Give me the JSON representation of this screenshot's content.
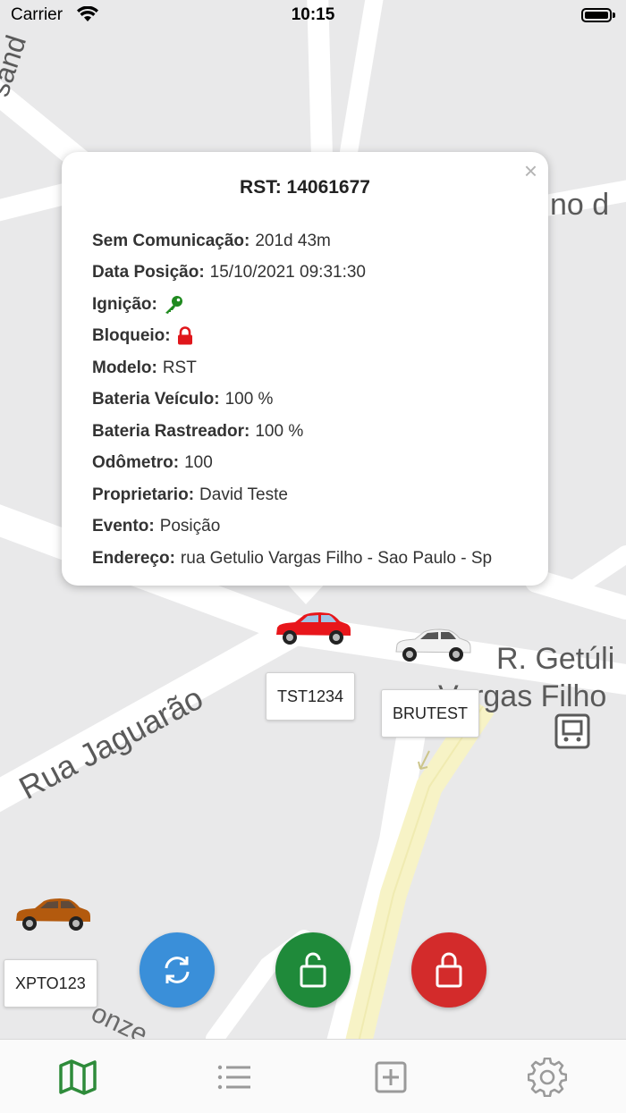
{
  "status_bar": {
    "carrier": "Carrier",
    "time": "10:15"
  },
  "map": {
    "street_labels": [
      "Rua Jaguarão",
      "R. Getúli",
      "Vargas Filho",
      "no d",
      "sand",
      "onze"
    ]
  },
  "popup": {
    "close_symbol": "×",
    "title": "RST: 14061677",
    "rows": [
      {
        "label": "Sem Comunicação:",
        "value": "201d 43m"
      },
      {
        "label": "Data Posição:",
        "value": "15/10/2021 09:31:30"
      },
      {
        "label": "Ignição:",
        "value": "",
        "icon": "key-icon",
        "icon_color": "#1f8a1f"
      },
      {
        "label": "Bloqueio:",
        "value": "",
        "icon": "lock-icon",
        "icon_color": "#e0161b"
      },
      {
        "label": "Modelo:",
        "value": "RST"
      },
      {
        "label": "Bateria Veículo:",
        "value": "100 %"
      },
      {
        "label": "Bateria Rastreador:",
        "value": "100 %"
      },
      {
        "label": "Odômetro:",
        "value": "100"
      },
      {
        "label": "Proprietario:",
        "value": "David Teste"
      },
      {
        "label": "Evento:",
        "value": "Posição"
      },
      {
        "label": "Endereço:",
        "value": "rua Getulio Vargas Filho - Sao Paulo - Sp"
      }
    ]
  },
  "vehicles": [
    {
      "plate": "TST1234",
      "color": "#e8161b"
    },
    {
      "plate": "BRUTEST",
      "color": "#f2f2f2"
    },
    {
      "plate": "XPTO123",
      "color": "#b35a0e"
    }
  ],
  "actions": {
    "refresh": {
      "icon": "refresh-icon",
      "color": "#3a8fd9"
    },
    "unlock": {
      "icon": "unlock-icon",
      "color": "#1f8a3a"
    },
    "lock": {
      "icon": "lock-icon",
      "color": "#d32b2b"
    }
  },
  "tabbar": {
    "tabs": [
      {
        "icon": "map-icon",
        "active": true
      },
      {
        "icon": "list-icon",
        "active": false
      },
      {
        "icon": "add-square-icon",
        "active": false
      },
      {
        "icon": "gear-icon",
        "active": false
      }
    ],
    "active_color": "#2e8b3a",
    "inactive_color": "#9a9a9a"
  }
}
